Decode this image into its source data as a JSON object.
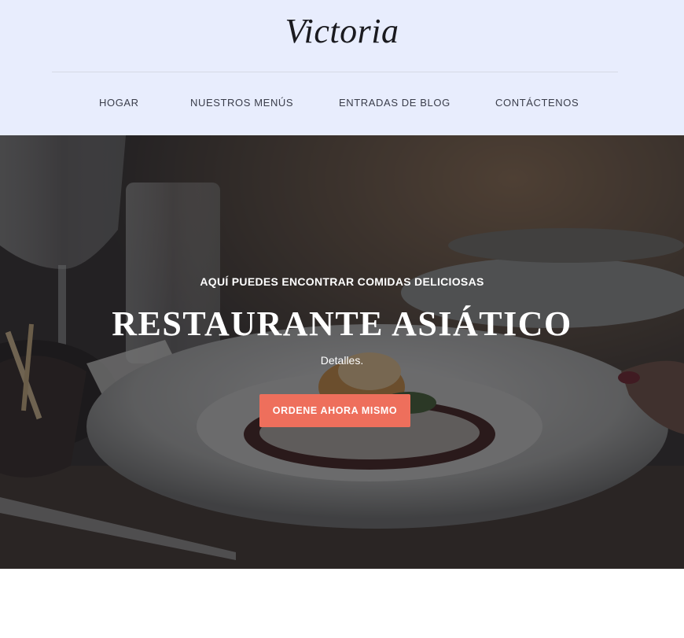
{
  "brand": {
    "name": "Victoria"
  },
  "nav": {
    "items": [
      {
        "label": "HOGAR"
      },
      {
        "label": "NUESTROS MENÚS"
      },
      {
        "label": "ENTRADAS DE BLOG"
      },
      {
        "label": "CONTÁCTENOS"
      }
    ]
  },
  "hero": {
    "kicker": "AQUÍ PUEDES ENCONTRAR COMIDAS DELICIOSAS",
    "title": "RESTAURANTE ASIÁTICO",
    "subtitle": "Detalles.",
    "cta_label": "ORDENE AHORA MISMO",
    "background": "restaurant-dinner-table-photo"
  },
  "colors": {
    "header_bg": "#e8edfd",
    "cta": "#ee6f5c",
    "nav_text": "#3a3d4a"
  }
}
